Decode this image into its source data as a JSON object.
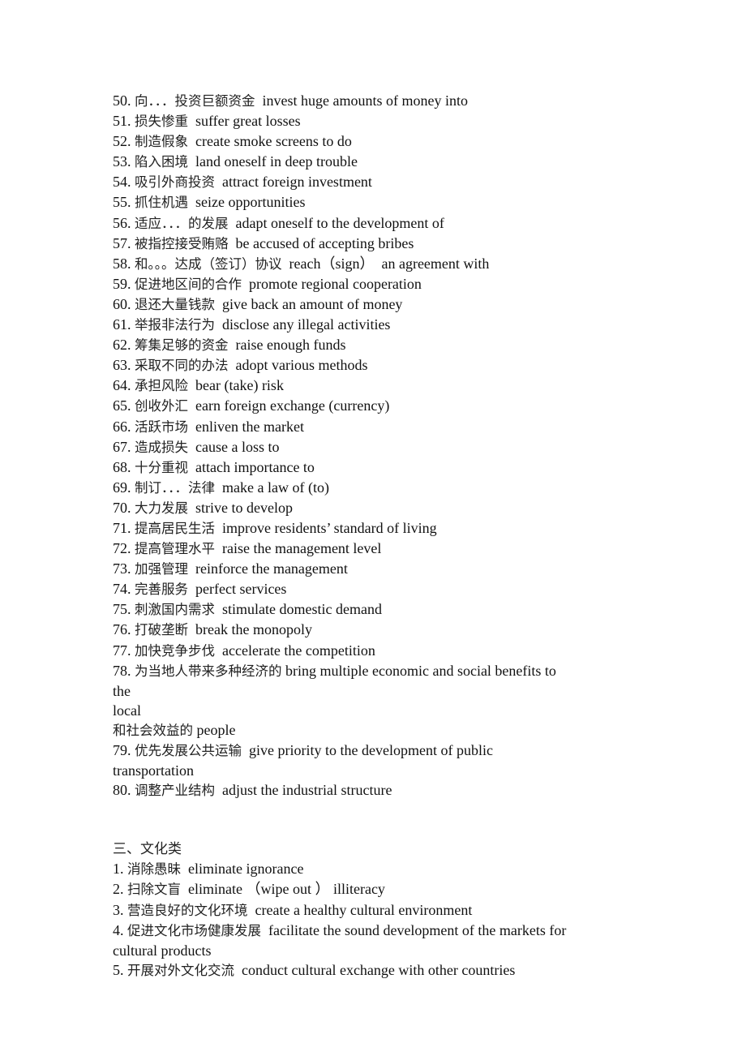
{
  "section_2_items": [
    {
      "num": "50.",
      "zh": "向．．．投资巨额资金",
      "en": "invest huge amounts of money into"
    },
    {
      "num": "51.",
      "zh": "损失惨重",
      "en": "suffer great losses"
    },
    {
      "num": "52.",
      "zh": "制造假象",
      "en": "create smoke screens to do"
    },
    {
      "num": "53.",
      "zh": "陷入困境",
      "en": "land oneself in deep trouble"
    },
    {
      "num": "54.",
      "zh": "吸引外商投资",
      "en": "attract foreign investment"
    },
    {
      "num": "55.",
      "zh": "抓住机遇",
      "en": "seize opportunities"
    },
    {
      "num": "56.",
      "zh": "适应．．．的发展",
      "en": "adapt oneself to the development of"
    },
    {
      "num": "57.",
      "zh": "被指控接受贿赂",
      "en": "be accused of accepting bribes"
    },
    {
      "num": "58.",
      "zh": "和。。。达成（签订）协议",
      "en": "reach（sign）  an agreement with"
    },
    {
      "num": "59.",
      "zh": "促进地区间的合作",
      "en": "promote regional cooperation"
    },
    {
      "num": "60.",
      "zh": "退还大量钱款",
      "en": "give back an amount of money"
    },
    {
      "num": "61.",
      "zh": "举报非法行为",
      "en": "disclose any illegal activities"
    },
    {
      "num": "62.",
      "zh": "筹集足够的资金",
      "en": "raise enough funds"
    },
    {
      "num": "63.",
      "zh": "采取不同的办法",
      "en": "adopt various methods"
    },
    {
      "num": "64.",
      "zh": "承担风险",
      "en": "bear (take) risk"
    },
    {
      "num": "65.",
      "zh": "创收外汇",
      "en": "earn foreign exchange (currency)"
    },
    {
      "num": "66.",
      "zh": "活跃市场",
      "en": "enliven the market"
    },
    {
      "num": "67.",
      "zh": "造成损失",
      "en": "cause a loss to"
    },
    {
      "num": "68.",
      "zh": "十分重视",
      "en": "attach importance to"
    },
    {
      "num": "69.",
      "zh": "制订．．．法律",
      "en": "make a law of (to)"
    },
    {
      "num": "70.",
      "zh": "大力发展",
      "en": "strive to develop"
    },
    {
      "num": "71.",
      "zh": "提高居民生活",
      "en": "improve residents’ standard of living"
    },
    {
      "num": "72.",
      "zh": "提高管理水平",
      "en": "raise the management level"
    },
    {
      "num": "73.",
      "zh": "加强管理",
      "en": "reinforce the management"
    },
    {
      "num": "74.",
      "zh": "完善服务",
      "en": "perfect services"
    },
    {
      "num": "75.",
      "zh": "刺激国内需求",
      "en": "stimulate domestic demand"
    },
    {
      "num": "76.",
      "zh": "打破垄断",
      "en": "break the monopoly"
    },
    {
      "num": "77.",
      "zh": "加快竞争步伐",
      "en": "accelerate the competition"
    }
  ],
  "item_78": {
    "line1_num": "78.",
    "line1_zh": "为当地人带来多种经济的",
    "line1_en": "bring multiple economic and social benefits to",
    "line2": "the",
    "line3": "local",
    "line4_zh": "和社会效益的",
    "line4_en": "people"
  },
  "item_79": {
    "num": "79.",
    "zh": "优先发展公共运输",
    "en": "give priority to the development of public",
    "cont": "transportation"
  },
  "item_80": {
    "num": "80.",
    "zh": "调整产业结构",
    "en": "adjust the industrial structure"
  },
  "section_3": {
    "heading": "三、文化类",
    "items": [
      {
        "num": "1.",
        "zh": "消除愚昧",
        "en": "eliminate ignorance"
      },
      {
        "num": "2.",
        "zh": "扫除文盲",
        "en": "eliminate （wipe out ） illiteracy"
      },
      {
        "num": "3.",
        "zh": "营造良好的文化环境",
        "en": "create a healthy cultural environment"
      }
    ],
    "item_4": {
      "num": "4.",
      "zh": "促进文化市场健康发展",
      "en": "facilitate the sound development of the markets for",
      "cont": "cultural products"
    },
    "item_5": {
      "num": "5.",
      "zh": "开展对外文化交流",
      "en": "conduct cultural exchange with other countries"
    }
  }
}
